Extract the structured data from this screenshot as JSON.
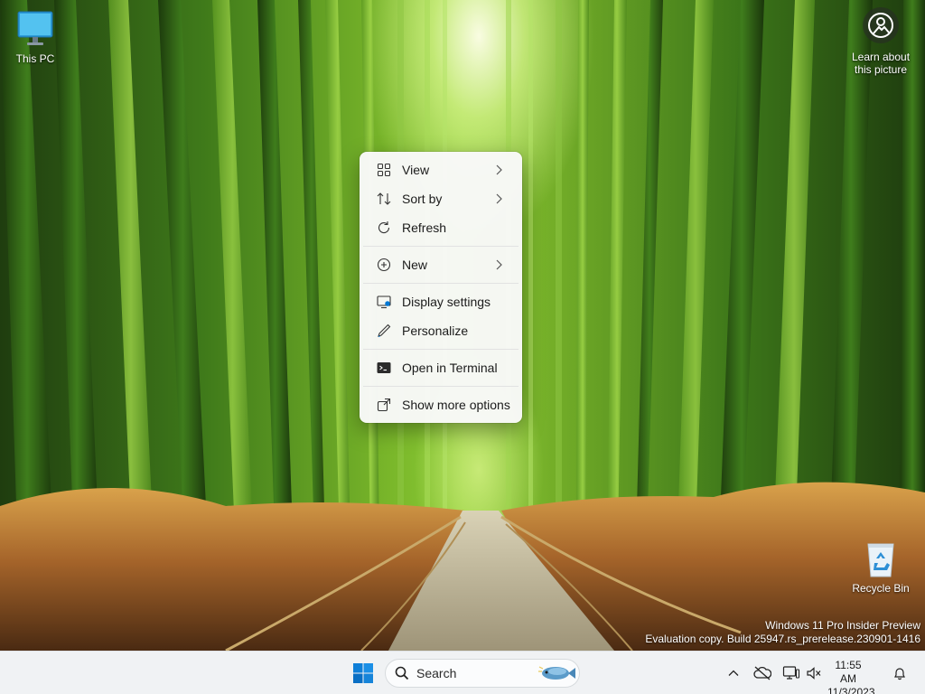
{
  "desktop": {
    "icons": [
      {
        "label": "This PC",
        "icon": "computer-icon"
      },
      {
        "label": "Recycle Bin",
        "icon": "recycle-bin-icon"
      }
    ],
    "learn_button": {
      "line1": "Learn about",
      "line2": "this picture",
      "icon": "spotlight-icon"
    },
    "watermark": {
      "line1": "Windows 11 Pro Insider Preview",
      "line2": "Evaluation copy. Build 25947.rs_prerelease.230901-1416"
    }
  },
  "context_menu": {
    "items": [
      {
        "label": "View",
        "icon": "view-grid-icon",
        "submenu": true
      },
      {
        "label": "Sort by",
        "icon": "sort-icon",
        "submenu": true
      },
      {
        "label": "Refresh",
        "icon": "refresh-icon",
        "submenu": false
      },
      {
        "label": "New",
        "icon": "new-plus-icon",
        "submenu": true
      },
      {
        "label": "Display settings",
        "icon": "display-settings-icon",
        "submenu": false
      },
      {
        "label": "Personalize",
        "icon": "personalize-pen-icon",
        "submenu": false
      },
      {
        "label": "Open in Terminal",
        "icon": "terminal-icon",
        "submenu": false
      },
      {
        "label": "Show more options",
        "icon": "show-more-icon",
        "submenu": false
      }
    ]
  },
  "taskbar": {
    "start_icon": "windows-start-icon",
    "search": {
      "label": "Search",
      "icon": "search-icon"
    },
    "tray": {
      "icons": [
        "chevron-up-icon",
        "onedrive-offline-icon",
        "network-icon",
        "volume-muted-icon"
      ],
      "time": "11:55 AM",
      "date": "11/3/2023",
      "notification_icon": "bell-icon"
    }
  },
  "colors": {
    "accent": "#0078d4",
    "menu_background": "#f9f9f9",
    "taskbar_background": "#f0f2f4"
  }
}
